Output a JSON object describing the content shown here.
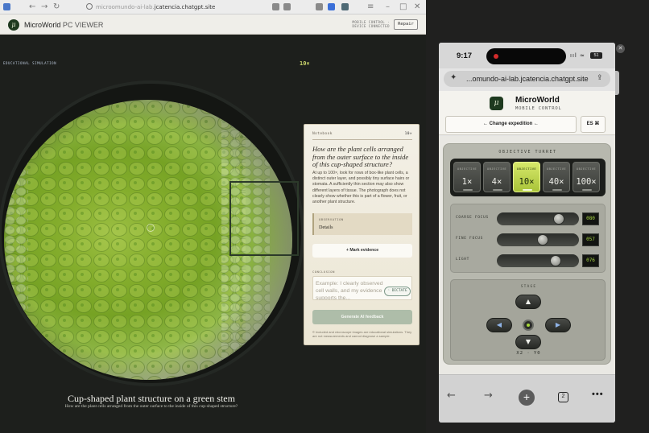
{
  "browser": {
    "url_prefix": "microomundo-ai-lab.",
    "url_domain": "jcatencia.chatgpt.site",
    "back": "←",
    "forward": "→",
    "reload": "↻",
    "window_min": "–",
    "window_max": "□",
    "window_close": "✕",
    "menu": "≡"
  },
  "app": {
    "logo_glyph": "μ",
    "title_bold": "MicroWorld",
    "title_light": " PC VIEWER",
    "mobile_control_status": "MOBILE CONTROL · DEVICE CONNECTED",
    "repair_button": "Repair",
    "educational_label": "EDUCATIONAL SIMULATION",
    "magnification": "10×"
  },
  "scene": {
    "caption": "Cup-shaped plant structure on a green stem",
    "subcaption": "How are the plant cells arranged from the outer surface to the inside of this cup-shaped structure?"
  },
  "notebook": {
    "header": "Notebook",
    "mag": "10×",
    "question": "How are the plant cells arranged from the outer surface to the inside of this cup-shaped structure?",
    "body": "At up to 100×, look for rows of box-like plant cells, a distinct outer layer, and possibly tiny surface hairs or stomata. A sufficiently thin section may also show different layers of tissue. The photograph does not clearly show whether this is part of a flower, fruit, or another plant structure.",
    "observation_label": "OBSERVATION",
    "observation_value": "Details",
    "mark_evidence": "+ Mark evidence",
    "conclusion_label": "CONCLUSION",
    "conclusion_placeholder": "Example: I clearly observed cell walls, and my evidence supports the...",
    "dictate": "◦ DICTATE",
    "generate": "Generate AI feedback",
    "footer": "© Included and microscope images are educational simulations. They are not measurements and cannot diagnose a sample."
  },
  "phone": {
    "close": "✕",
    "time": "9:17",
    "signal": "ııl ≈",
    "battery": "51",
    "url": "...omundo-ai-lab.jcatencia.chatgpt.site",
    "spark_icon": "✦",
    "share_icon": "⇪",
    "title": "MicroWorld",
    "subtitle": "MOBILE CONTROL",
    "change_expedition": "← Change expedition ←",
    "lang": "ES ⌘",
    "turret_label": "OBJECTIVE TURRET",
    "objective_label": "OBJECTIVE",
    "objectives": [
      {
        "value": "1×",
        "active": false
      },
      {
        "value": "4×",
        "active": false
      },
      {
        "value": "10×",
        "active": true
      },
      {
        "value": "40×",
        "active": false
      },
      {
        "value": "100×",
        "active": false
      }
    ],
    "controls": [
      {
        "label": "COARSE FOCUS",
        "value": "080",
        "level": 0.8
      },
      {
        "label": "FINE FOCUS",
        "value": "057",
        "level": 0.57
      },
      {
        "label": "LIGHT",
        "value": "076",
        "level": 0.76
      }
    ],
    "stage_label": "STAGE",
    "up": "▲",
    "down": "▼",
    "left": "◀",
    "right": "▶",
    "xy": "X2 · Y0",
    "nav_back": "←",
    "nav_forward": "→",
    "nav_add": "+",
    "nav_tabs": "2",
    "nav_more": "•••"
  }
}
